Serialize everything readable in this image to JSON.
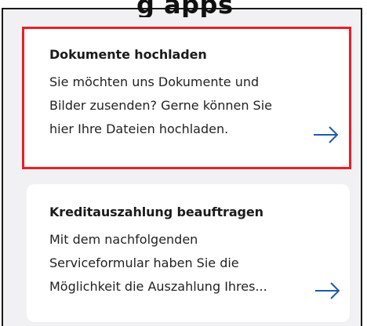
{
  "header": {
    "title_fragment": "g apps"
  },
  "cards": [
    {
      "title": "Dokumente hochladen",
      "lines": [
        "Sie möchten uns Dokumente und",
        "Bilder zusenden? Gerne können Sie",
        "hier Ihre Dateien hochladen."
      ],
      "icon": "arrow-right-icon"
    },
    {
      "title": "Kreditauszahlung beauftragen",
      "lines": [
        "Mit dem nachfolgenden",
        "Serviceformular haben Sie die",
        "Möglichkeit die Auszahlung Ihres..."
      ],
      "icon": "arrow-right-icon"
    }
  ],
  "colors": {
    "highlight": "#e8202a",
    "arrow": "#1f5aa8",
    "background": "#f1f1f3"
  }
}
